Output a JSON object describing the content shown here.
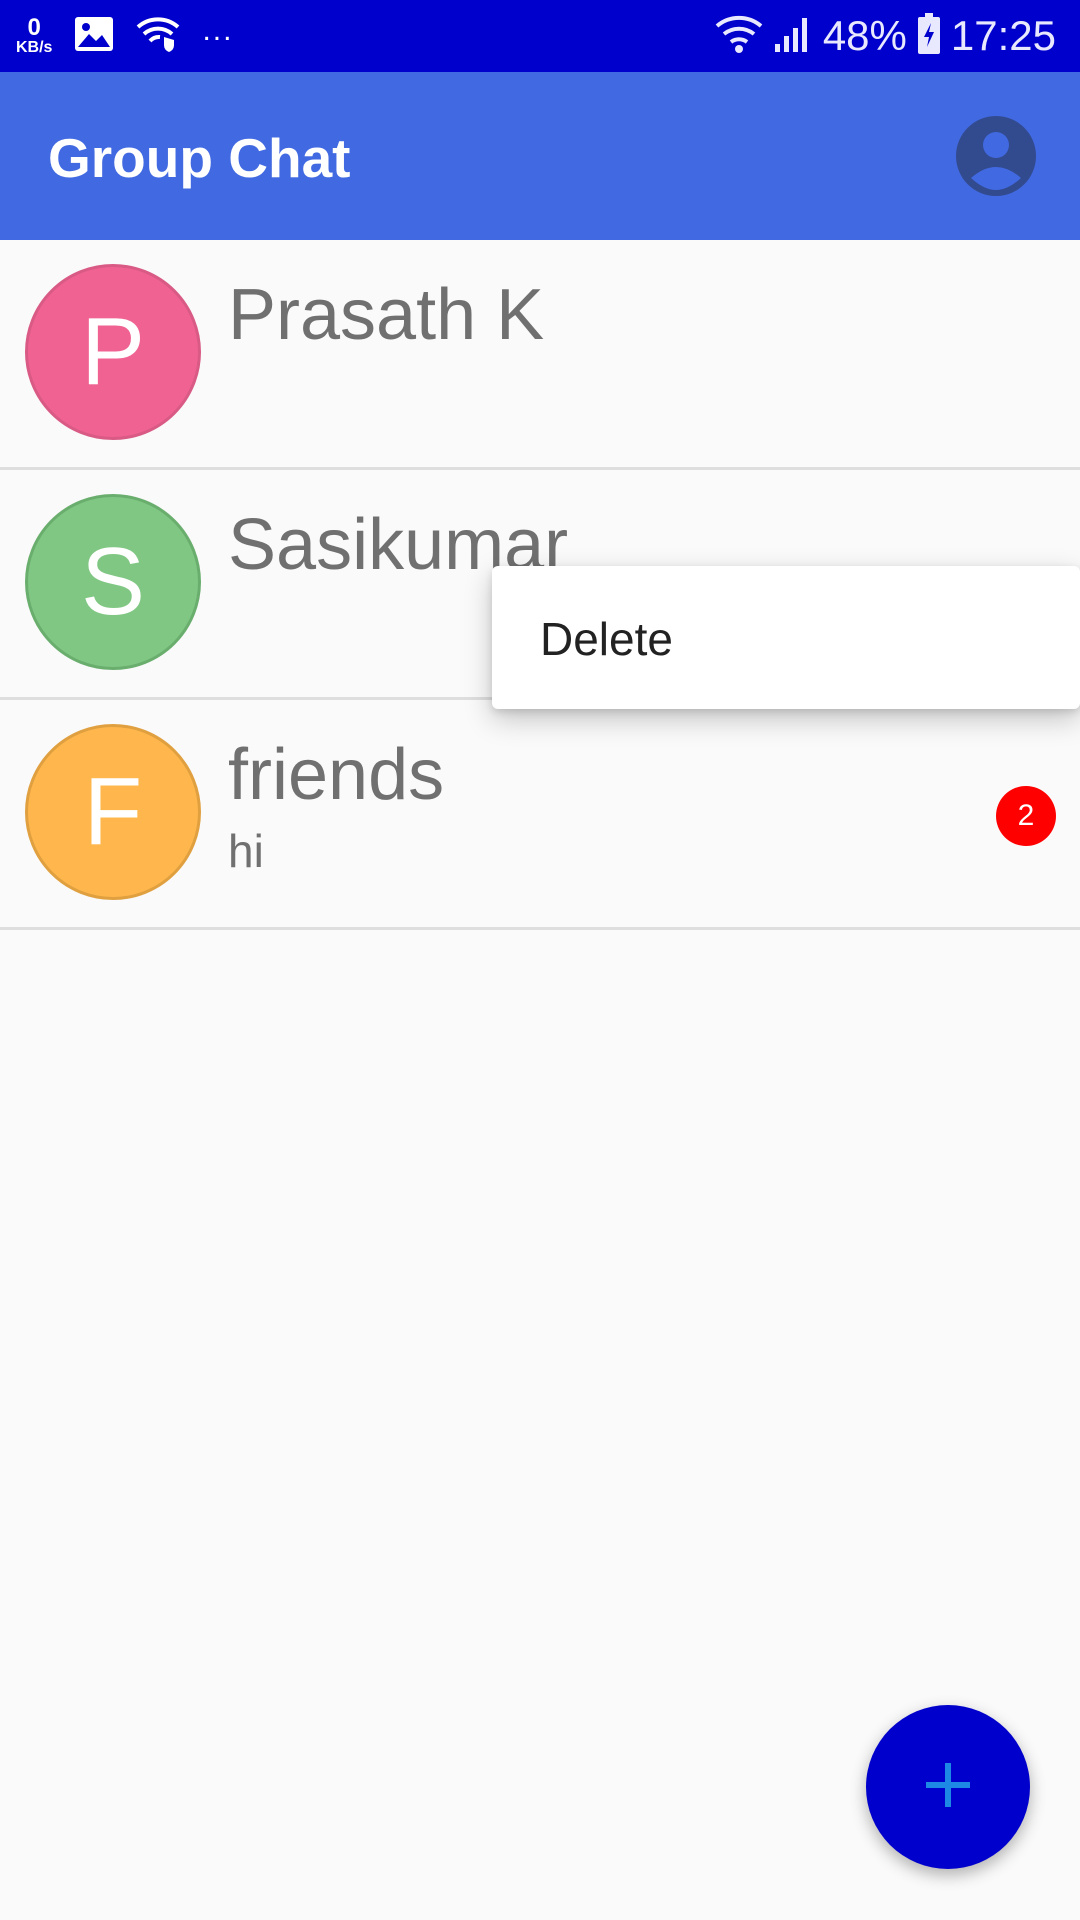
{
  "status_bar": {
    "net_speed_value": "0",
    "net_speed_unit": "KB/s",
    "overflow": "...",
    "battery": "48%",
    "time": "17:25",
    "icons": [
      "image-icon",
      "wifi-shield-icon",
      "wifi-icon",
      "signal-icon",
      "battery-charging-icon"
    ]
  },
  "app_bar": {
    "title": "Group Chat",
    "profile_icon": "account-circle-icon"
  },
  "chats": [
    {
      "initial": "P",
      "name": "Prasath K",
      "last_message": "",
      "unread": "",
      "color": "#f06292"
    },
    {
      "initial": "S",
      "name": "Sasikumar",
      "last_message": "",
      "unread": "",
      "color": "#81c784"
    },
    {
      "initial": "F",
      "name": "friends",
      "last_message": "hi",
      "unread": "2",
      "color": "#ffb74d"
    }
  ],
  "context_menu": {
    "items": [
      {
        "label": "Delete"
      }
    ]
  },
  "fab": {
    "icon": "plus-icon",
    "accent": "#1e88e5"
  },
  "colors": {
    "status_bar": "#0000cc",
    "app_bar": "#4169e1",
    "badge": "#ff0000",
    "fab": "#0000cc"
  }
}
